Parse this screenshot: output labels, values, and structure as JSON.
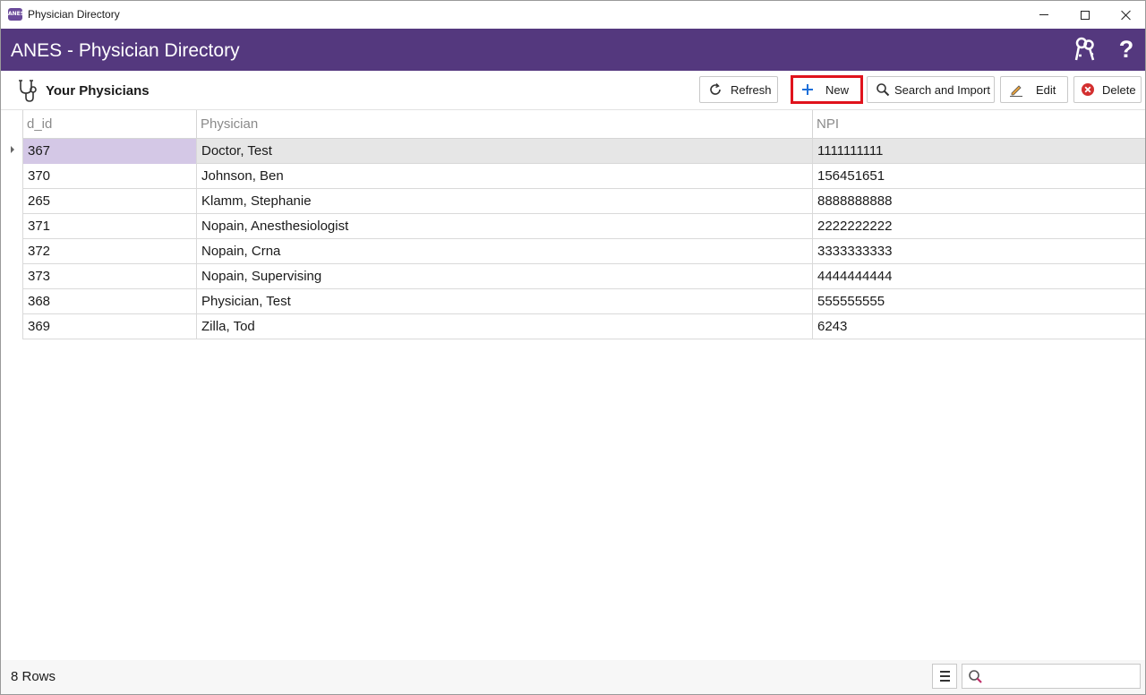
{
  "window": {
    "title": "Physician Directory",
    "app_icon_text": "ANES"
  },
  "header": {
    "title": "ANES - Physician Directory",
    "help_symbol": "?"
  },
  "toolbar": {
    "section_title": "Your Physicians",
    "refresh_label": "Refresh",
    "new_label": "New",
    "search_import_label": "Search and Import",
    "edit_label": "Edit",
    "delete_label": "Delete"
  },
  "grid": {
    "columns": [
      "d_id",
      "Physician",
      "NPI"
    ],
    "rows": [
      {
        "d_id": "367",
        "physician": "Doctor, Test",
        "npi": "1111111111"
      },
      {
        "d_id": "370",
        "physician": "Johnson, Ben",
        "npi": "156451651"
      },
      {
        "d_id": "265",
        "physician": "Klamm, Stephanie",
        "npi": "8888888888"
      },
      {
        "d_id": "371",
        "physician": "Nopain, Anesthesiologist",
        "npi": "2222222222"
      },
      {
        "d_id": "372",
        "physician": "Nopain, Crna",
        "npi": "3333333333"
      },
      {
        "d_id": "373",
        "physician": "Nopain, Supervising",
        "npi": "4444444444"
      },
      {
        "d_id": "368",
        "physician": "Physician, Test",
        "npi": "555555555"
      },
      {
        "d_id": "369",
        "physician": "Zilla, Tod",
        "npi": "6243"
      }
    ]
  },
  "footer": {
    "row_count": "8 Rows",
    "search_value": "",
    "search_placeholder": ""
  },
  "colors": {
    "header_bg": "#54387e",
    "selected_cell": "#d4c8e6",
    "highlight_border": "#e0131c",
    "delete_icon": "#d32f2f",
    "new_icon": "#1e6fd9"
  },
  "icons": {
    "app": "app-icon",
    "section": "stethoscope-icon",
    "header_keys": "keys-icon",
    "header_help": "help-icon",
    "refresh": "refresh-icon",
    "new": "plus-icon",
    "search_import": "magnifier-icon",
    "edit": "pencil-icon",
    "delete": "delete-circle-icon",
    "footer_menu": "menu-icon",
    "footer_search": "search-icon"
  }
}
